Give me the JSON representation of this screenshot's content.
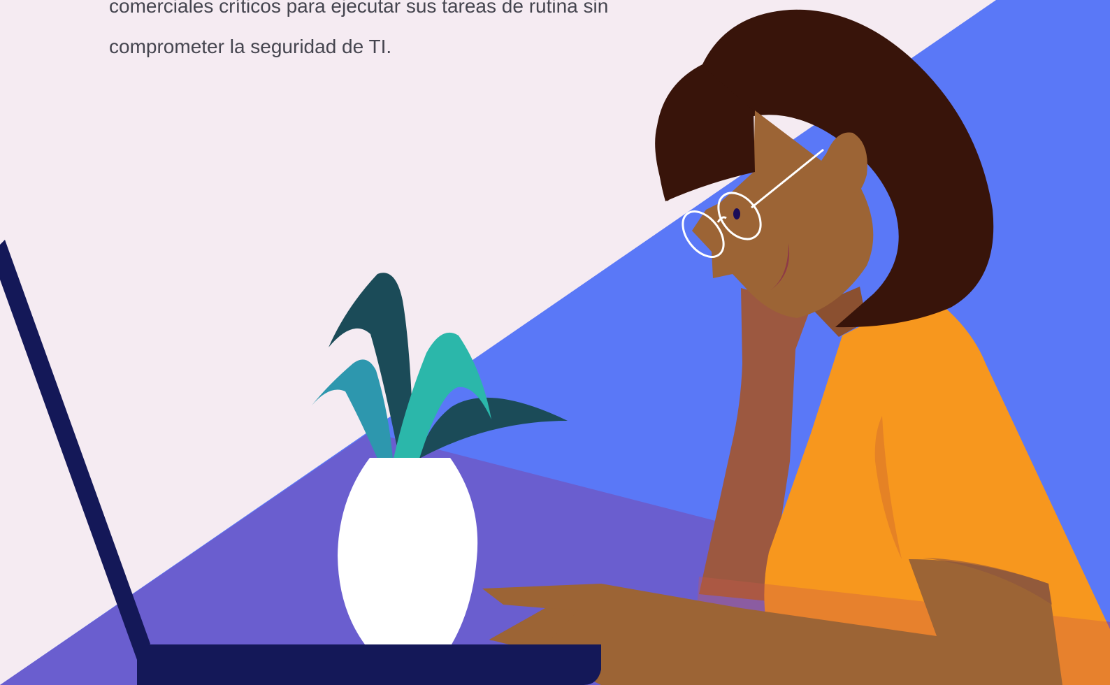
{
  "intro_text": {
    "line1": "comerciales críticos para ejecutar sus tareas de rutina sin",
    "line2": "comprometer la seguridad de TI."
  },
  "colors": {
    "background": "#f5ebf2",
    "blue_panel": "#5a78f7",
    "desk": "#6a5ecf",
    "laptop": "#141858",
    "shirt": "#f7971e",
    "skin": "#9c6435",
    "hair": "#38140a",
    "plant_dark": "#1b4b58",
    "plant_teal": "#2bb7aa",
    "plant_blue": "#2d97ae",
    "vase": "#ffffff"
  }
}
